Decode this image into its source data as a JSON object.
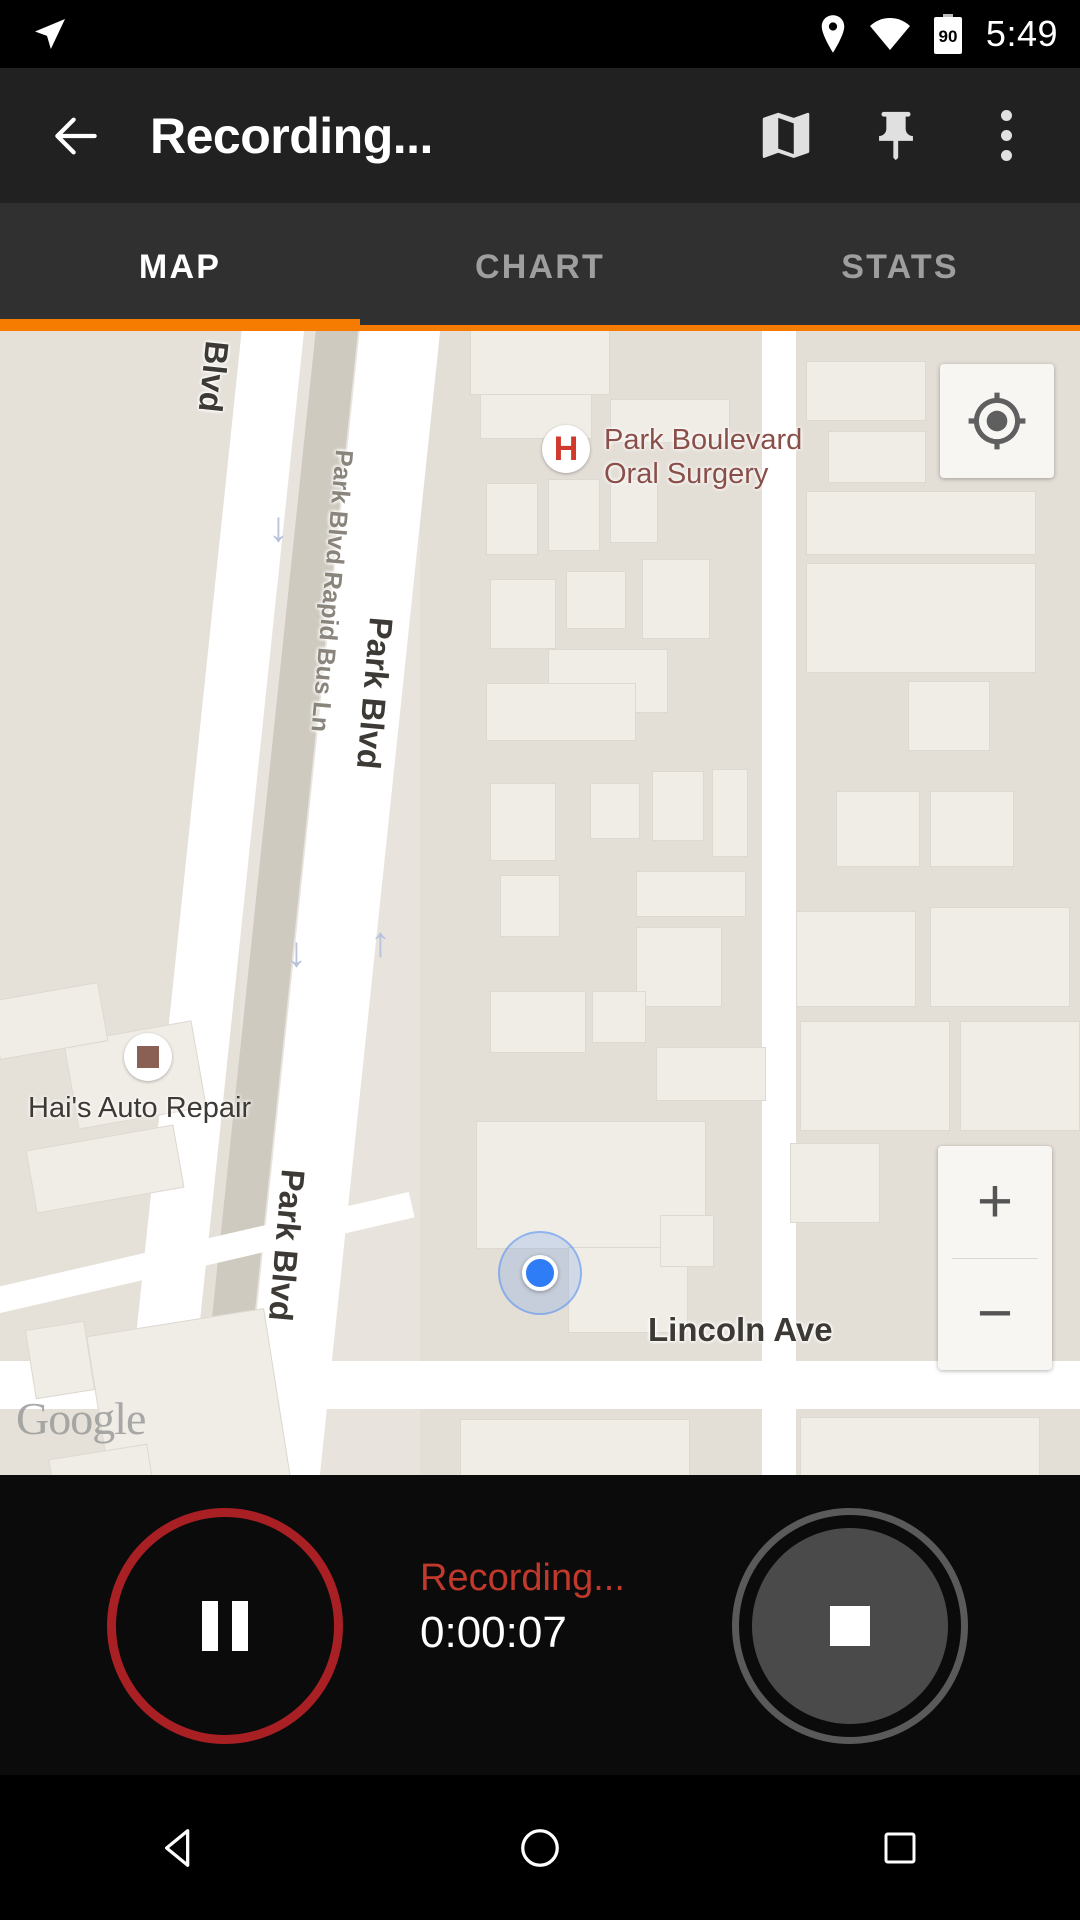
{
  "status_bar": {
    "nav_icon": "navigation-arrow-icon",
    "location_icon": "location-pin-icon",
    "wifi_icon": "wifi-icon",
    "battery_level": "90",
    "time": "5:49"
  },
  "app_bar": {
    "back_icon": "back-arrow-icon",
    "title": "Recording...",
    "actions": [
      {
        "name": "map-layer-icon",
        "label": "Map"
      },
      {
        "name": "pin-icon",
        "label": "Pin"
      },
      {
        "name": "overflow-menu-icon",
        "label": "More options"
      }
    ]
  },
  "tabs": {
    "active_index": 0,
    "items": [
      {
        "label": "MAP"
      },
      {
        "label": "CHART"
      },
      {
        "label": "STATS"
      }
    ],
    "indicator_color": "#F57C00"
  },
  "map": {
    "provider_logo": "Google",
    "street_labels": [
      {
        "text": "Blvd"
      },
      {
        "text": "Park Blvd"
      },
      {
        "text": "Park Blvd"
      },
      {
        "text": "Park Blvd Rapid Bus Ln"
      },
      {
        "text": "Lincoln Ave"
      }
    ],
    "pois": [
      {
        "name": "Park Boulevard Oral Surgery",
        "line1": "Park Boulevard",
        "line2": "Oral Surgery",
        "marker": "hospital-H-marker"
      },
      {
        "name": "Hai's Auto Repair",
        "line1": "Hai's Auto Repair",
        "marker": "square-poi-marker"
      }
    ],
    "controls": {
      "my_location": "my-location-icon",
      "zoom_in": "+",
      "zoom_out": "−"
    },
    "user_location_marker": "blue-dot-current-location"
  },
  "controls": {
    "pause_label": "Pause",
    "status_text": "Recording...",
    "timer": "0:00:07",
    "stop_label": "Stop",
    "recording_color": "#C0392B"
  },
  "system_nav": {
    "back": "triangle-back-icon",
    "home": "circle-home-icon",
    "recents": "square-recents-icon"
  }
}
